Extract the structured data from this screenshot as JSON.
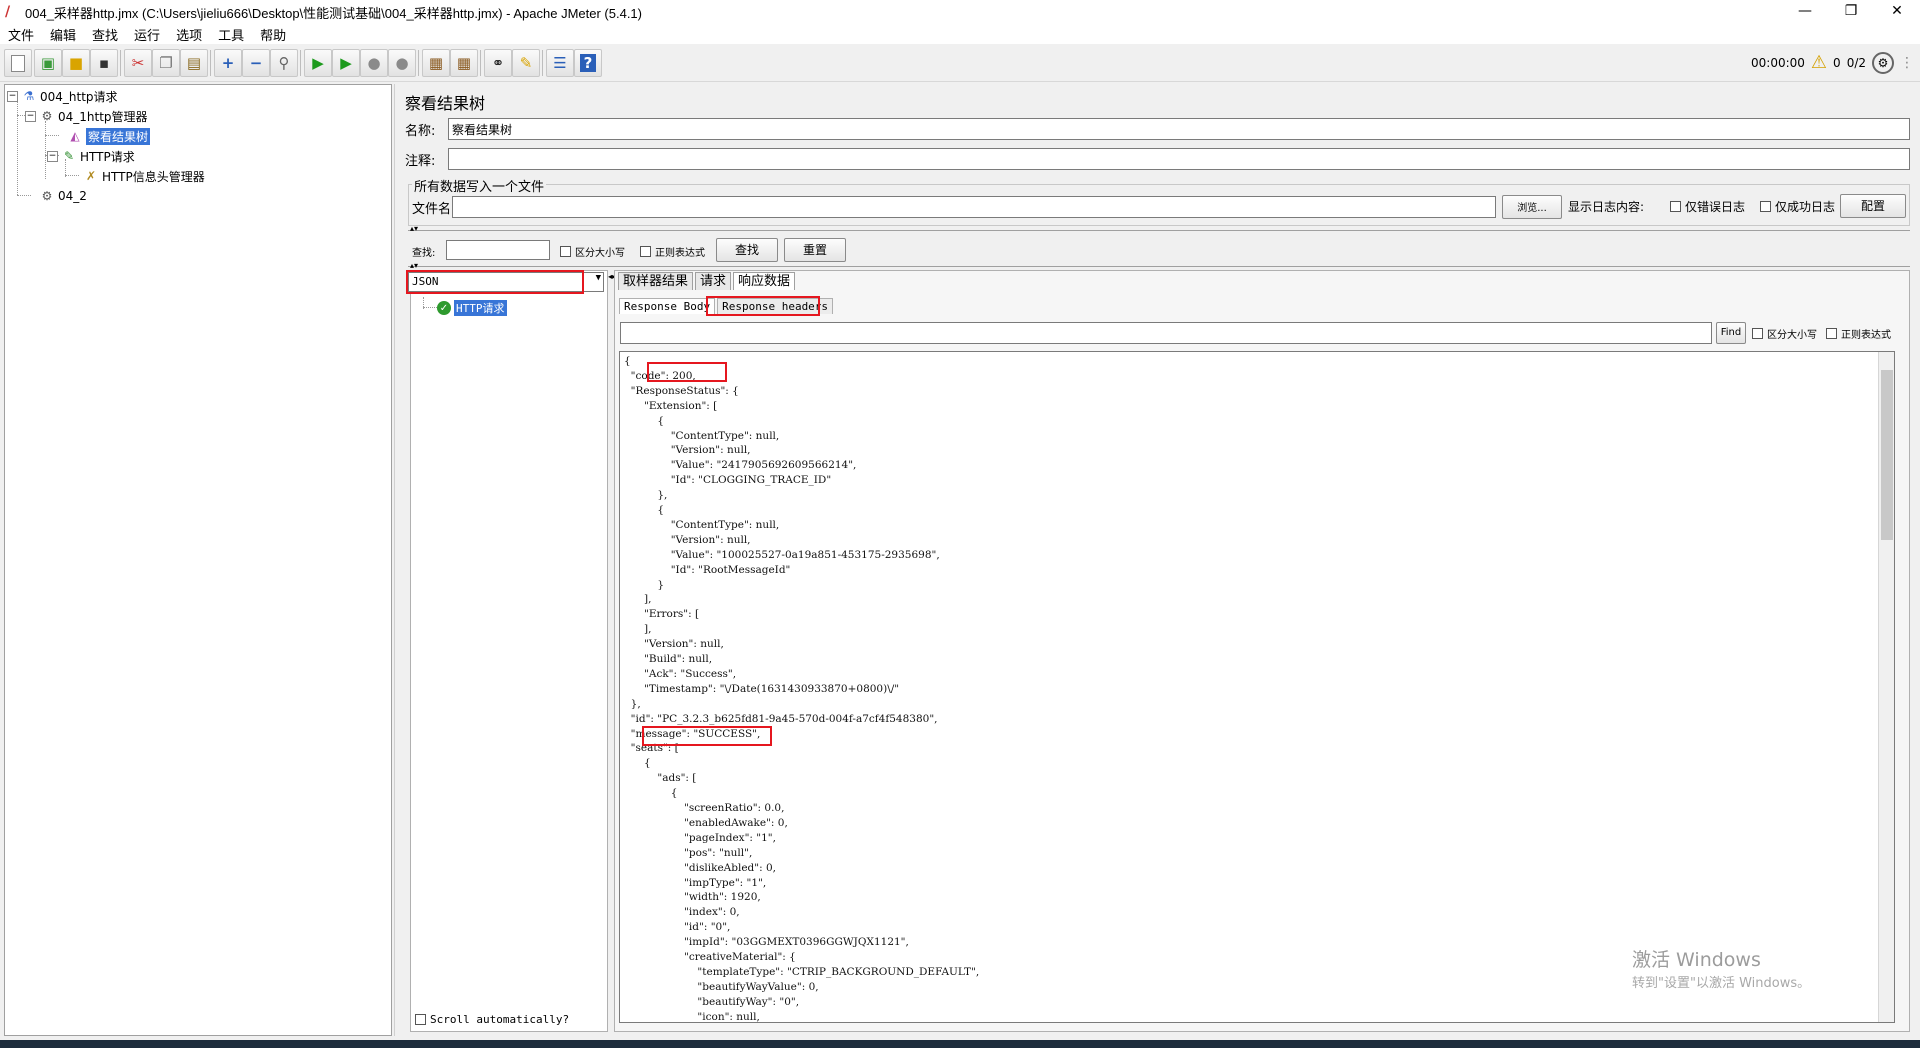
{
  "window": {
    "title": "004_采样器http.jmx (C:\\Users\\jieliu666\\Desktop\\性能测试基础\\004_采样器http.jmx) - Apache JMeter (5.4.1)",
    "minimize": "—",
    "maximize": "❐",
    "close": "✕"
  },
  "menu": [
    "文件",
    "编辑",
    "查找",
    "运行",
    "选项",
    "工具",
    "帮助"
  ],
  "toolbar": {
    "timer": "00:00:00",
    "warning_count": "0",
    "threads": "0/2"
  },
  "tree": {
    "root": "004_http请求",
    "thread_group": "04_1http管理器",
    "listener": "察看结果树",
    "sampler": "HTTP请求",
    "header_manager": "HTTP信息头管理器",
    "thread_group2": "04_2"
  },
  "panel": {
    "title": "察看结果树",
    "name_label": "名称:",
    "name_value": "察看结果树",
    "comment_label": "注释:",
    "comment_value": "",
    "file_legend": "所有数据写入一个文件",
    "filename_label": "文件名",
    "browse": "浏览...",
    "log_content_label": "显示日志内容:",
    "errors_only": "仅错误日志",
    "success_only": "仅成功日志",
    "configure": "配置",
    "search_label": "查找:",
    "case_sensitive": "区分大小写",
    "regex": "正则表达式",
    "find_btn": "查找",
    "reset_btn": "重置"
  },
  "results": {
    "renderer": "JSON",
    "sample_item": "HTTP请求",
    "scroll_auto": "Scroll automatically?",
    "tabs": [
      "取样器结果",
      "请求",
      "响应数据"
    ],
    "subtabs": [
      "Response Body",
      "Response headers"
    ],
    "find_btn": "Find",
    "case_sensitive": "区分大小写",
    "regex": "正则表达式"
  },
  "json_lines": [
    "{",
    "  \"code\": 200,",
    "  \"ResponseStatus\": {",
    "      \"Extension\": [",
    "          {",
    "              \"ContentType\": null,",
    "              \"Version\": null,",
    "              \"Value\": \"2417905692609566214\",",
    "              \"Id\": \"CLOGGING_TRACE_ID\"",
    "          },",
    "          {",
    "              \"ContentType\": null,",
    "              \"Version\": null,",
    "              \"Value\": \"100025527-0a19a851-453175-2935698\",",
    "              \"Id\": \"RootMessageId\"",
    "          }",
    "      ],",
    "      \"Errors\": [",
    "      ],",
    "      \"Version\": null,",
    "      \"Build\": null,",
    "      \"Ack\": \"Success\",",
    "      \"Timestamp\": \"\\/Date(1631430933870+0800)\\/\"",
    "  },",
    "  \"id\": \"PC_3.2.3_b625fd81-9a45-570d-004f-a7cf4f548380\",",
    "  \"message\": \"SUCCESS\",",
    "  \"seats\": [",
    "      {",
    "          \"ads\": [",
    "              {",
    "                  \"screenRatio\": 0.0,",
    "                  \"enabledAwake\": 0,",
    "                  \"pageIndex\": \"1\",",
    "                  \"pos\": \"null\",",
    "                  \"dislikeAbled\": 0,",
    "                  \"impType\": \"1\",",
    "                  \"width\": 1920,",
    "                  \"index\": 0,",
    "                  \"id\": \"0\",",
    "                  \"impId\": \"03GGMEXT0396GGWJQX1121\",",
    "                  \"creativeMaterial\": {",
    "                      \"templateType\": \"CTRIP_BACKGROUND_DEFAULT\",",
    "                      \"beautifyWayValue\": 0,",
    "                      \"beautifyWay\": \"0\",",
    "                      \"icon\": null,"
  ],
  "watermark": {
    "line1": "激活 Windows",
    "line2": "转到\"设置\"以激活 Windows。"
  }
}
